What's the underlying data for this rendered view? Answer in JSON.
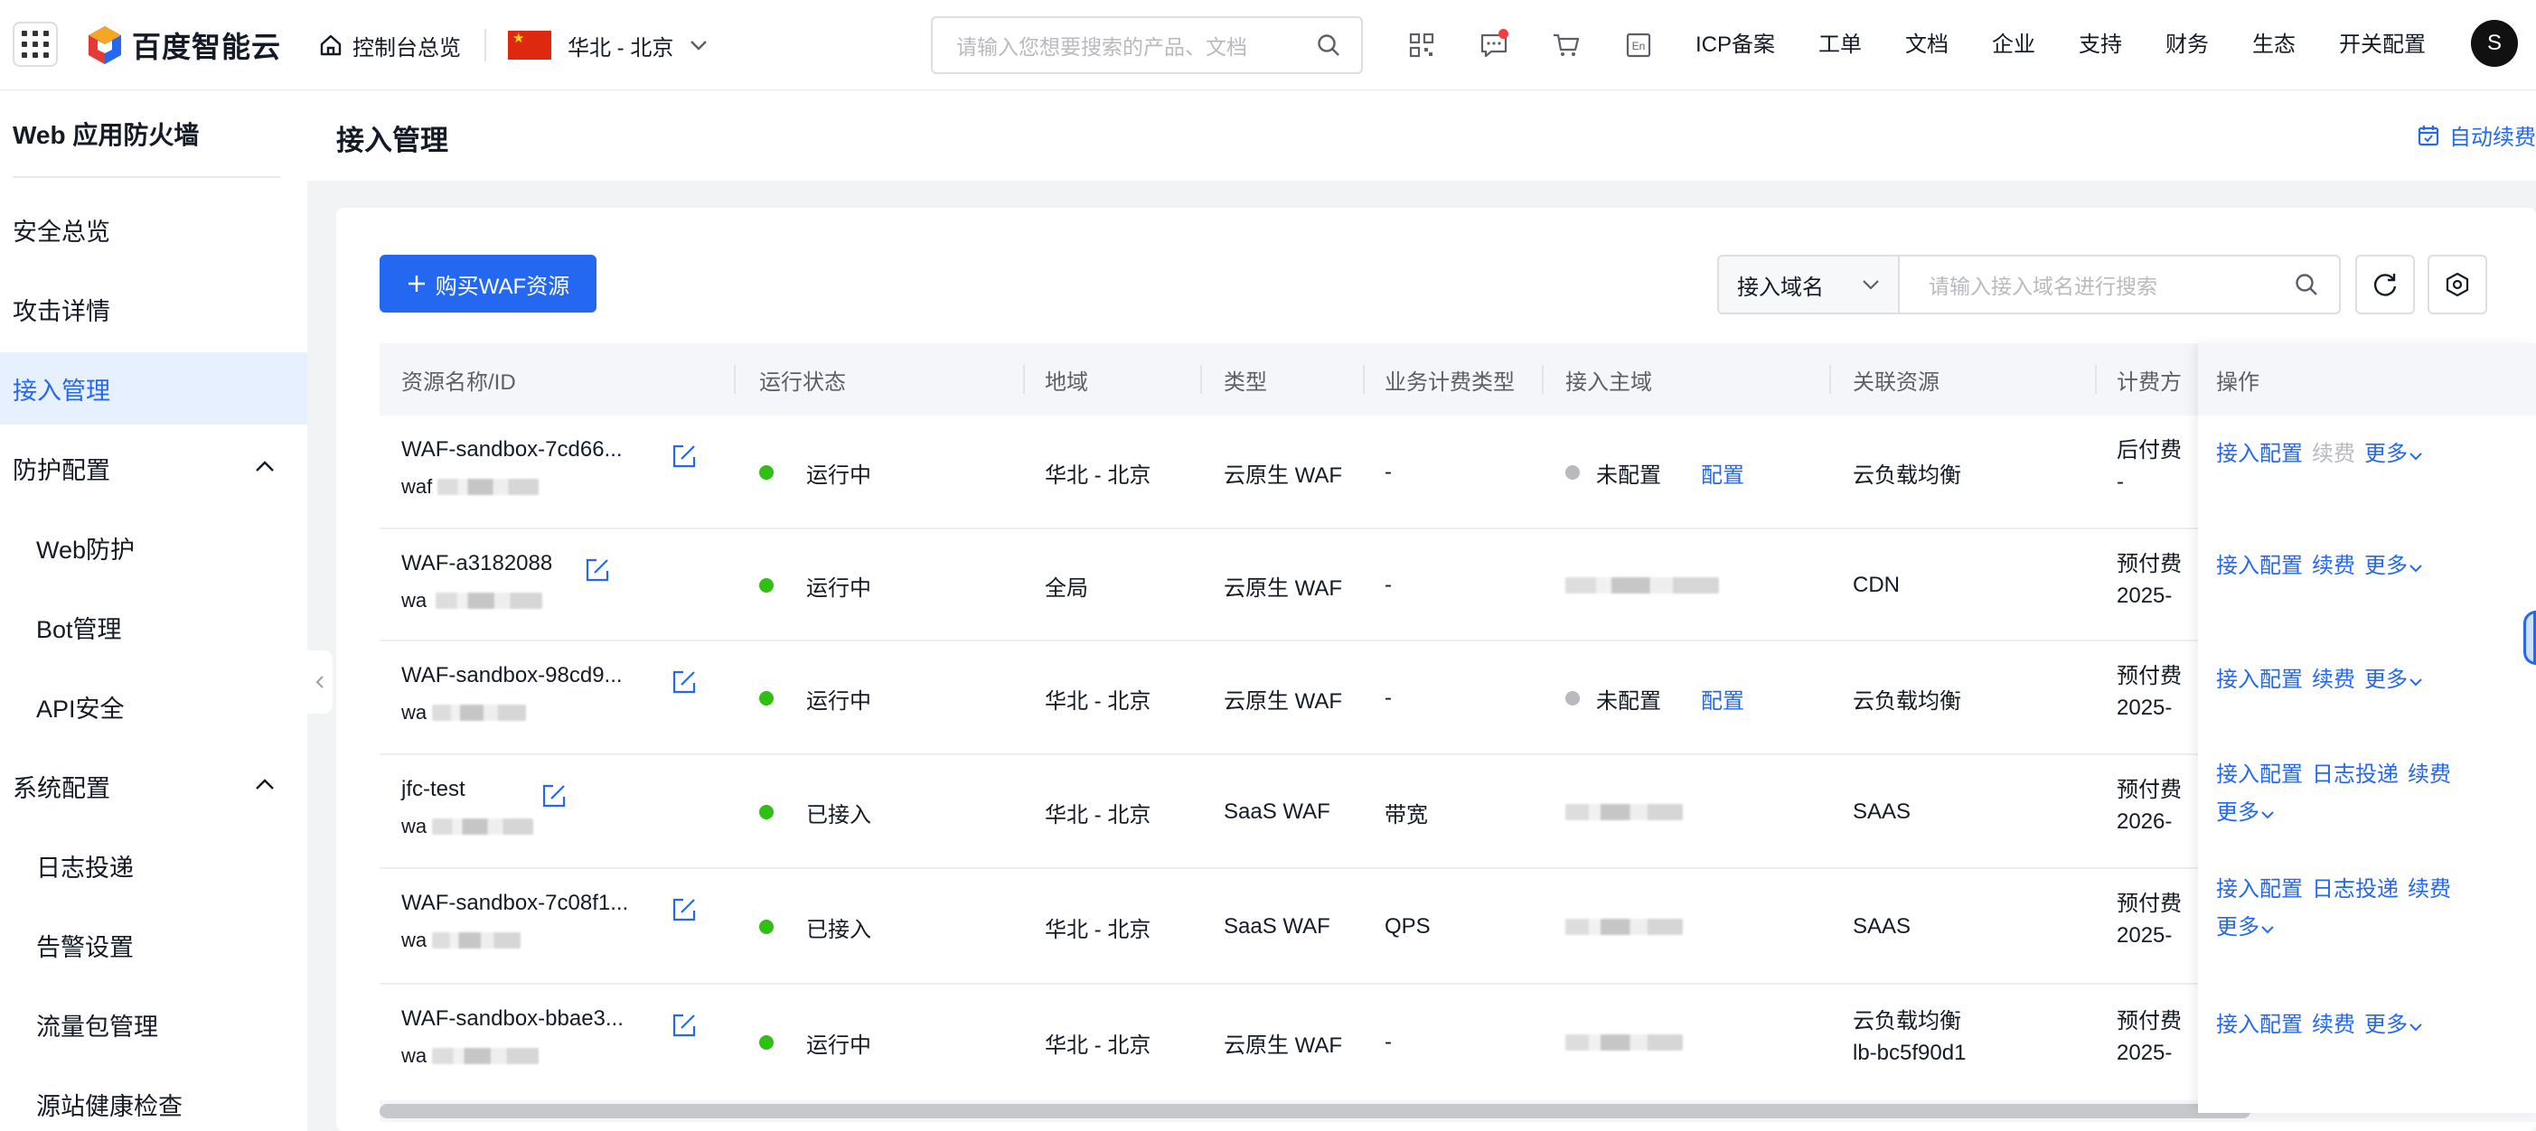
{
  "topbar": {
    "logo_text": "百度智能云",
    "console_label": "控制台总览",
    "region_label": "华北 - 北京",
    "search_placeholder": "请输入您想要搜索的产品、文档",
    "nav_links": [
      "ICP备案",
      "工单",
      "文档",
      "企业",
      "支持",
      "财务",
      "生态",
      "开关配置"
    ],
    "en_label": "En",
    "avatar_letter": "S"
  },
  "sidebar": {
    "title": "Web 应用防火墙",
    "items": [
      {
        "label": "安全总览",
        "level": 1,
        "active": false
      },
      {
        "label": "攻击详情",
        "level": 1,
        "active": false
      },
      {
        "label": "接入管理",
        "level": 1,
        "active": true
      },
      {
        "label": "防护配置",
        "level": 1,
        "active": false,
        "expanded": true
      },
      {
        "label": "Web防护",
        "level": 2,
        "active": false
      },
      {
        "label": "Bot管理",
        "level": 2,
        "active": false
      },
      {
        "label": "API安全",
        "level": 2,
        "active": false
      },
      {
        "label": "系统配置",
        "level": 1,
        "active": false,
        "expanded": true
      },
      {
        "label": "日志投递",
        "level": 2,
        "active": false
      },
      {
        "label": "告警设置",
        "level": 2,
        "active": false
      },
      {
        "label": "流量包管理",
        "level": 2,
        "active": false
      },
      {
        "label": "源站健康检查",
        "level": 2,
        "active": false
      }
    ]
  },
  "page": {
    "title": "接入管理",
    "auto_renew": "自动续费"
  },
  "toolbar": {
    "buy_button": "购买WAF资源",
    "filter_select": "接入域名",
    "filter_placeholder": "请输入接入域名进行搜索"
  },
  "table": {
    "headers": [
      "资源名称/ID",
      "运行状态",
      "地域",
      "类型",
      "业务计费类型",
      "接入主域",
      "关联资源",
      "计费方",
      "操作"
    ],
    "rows": [
      {
        "name": "WAF-sandbox-7cd66...",
        "id_prefix": "waf",
        "status": "运行中",
        "region": "华北 - 北京",
        "type": "云原生 WAF",
        "billing_type": "-",
        "domain_status": "未配置",
        "domain_action": "配置",
        "related": "云负载均衡",
        "related2": "",
        "pay": "后付费",
        "pay2": "-",
        "ops": [
          "接入配置",
          "续费",
          "更多"
        ],
        "ops_dim": [
          false,
          true,
          false
        ]
      },
      {
        "name": "WAF-a3182088",
        "id_prefix": "wa",
        "status": "运行中",
        "region": "全局",
        "type": "云原生 WAF",
        "billing_type": "-",
        "domain_status": "",
        "domain_action": "",
        "related": "CDN",
        "related2": "",
        "pay": "预付费",
        "pay2": "2025-",
        "ops": [
          "接入配置",
          "续费",
          "更多"
        ],
        "ops_dim": [
          false,
          false,
          false
        ]
      },
      {
        "name": "WAF-sandbox-98cd9...",
        "id_prefix": "wa",
        "status": "运行中",
        "region": "华北 - 北京",
        "type": "云原生 WAF",
        "billing_type": "-",
        "domain_status": "未配置",
        "domain_action": "配置",
        "related": "云负载均衡",
        "related2": "",
        "pay": "预付费",
        "pay2": "2025-",
        "ops": [
          "接入配置",
          "续费",
          "更多"
        ],
        "ops_dim": [
          false,
          false,
          false
        ]
      },
      {
        "name": "jfc-test",
        "id_prefix": "wa",
        "status": "已接入",
        "region": "华北 - 北京",
        "type": "SaaS WAF",
        "billing_type": "带宽",
        "domain_status": "",
        "domain_action": "",
        "related": "SAAS",
        "related2": "",
        "pay": "预付费",
        "pay2": "2026-",
        "ops": [
          "接入配置",
          "日志投递",
          "续费",
          "更多"
        ],
        "ops_dim": [
          false,
          false,
          false,
          false
        ]
      },
      {
        "name": "WAF-sandbox-7c08f1...",
        "id_prefix": "wa",
        "status": "已接入",
        "region": "华北 - 北京",
        "type": "SaaS WAF",
        "billing_type": "QPS",
        "domain_status": "",
        "domain_action": "",
        "related": "SAAS",
        "related2": "",
        "pay": "预付费",
        "pay2": "2025-",
        "ops": [
          "接入配置",
          "日志投递",
          "续费",
          "更多"
        ],
        "ops_dim": [
          false,
          false,
          false,
          false
        ]
      },
      {
        "name": "WAF-sandbox-bbae3...",
        "id_prefix": "wa",
        "status": "运行中",
        "region": "华北 - 北京",
        "type": "云原生 WAF",
        "billing_type": "-",
        "domain_status": "",
        "domain_action": "",
        "related": "云负载均衡",
        "related2": "lb-bc5f90d1",
        "pay": "预付费",
        "pay2": "2025-",
        "ops": [
          "接入配置",
          "续费",
          "更多"
        ],
        "ops_dim": [
          false,
          false,
          false
        ]
      }
    ]
  },
  "colors": {
    "accent": "#2468f2",
    "running": "#30bf13",
    "unconfigured": "#b8babf"
  }
}
